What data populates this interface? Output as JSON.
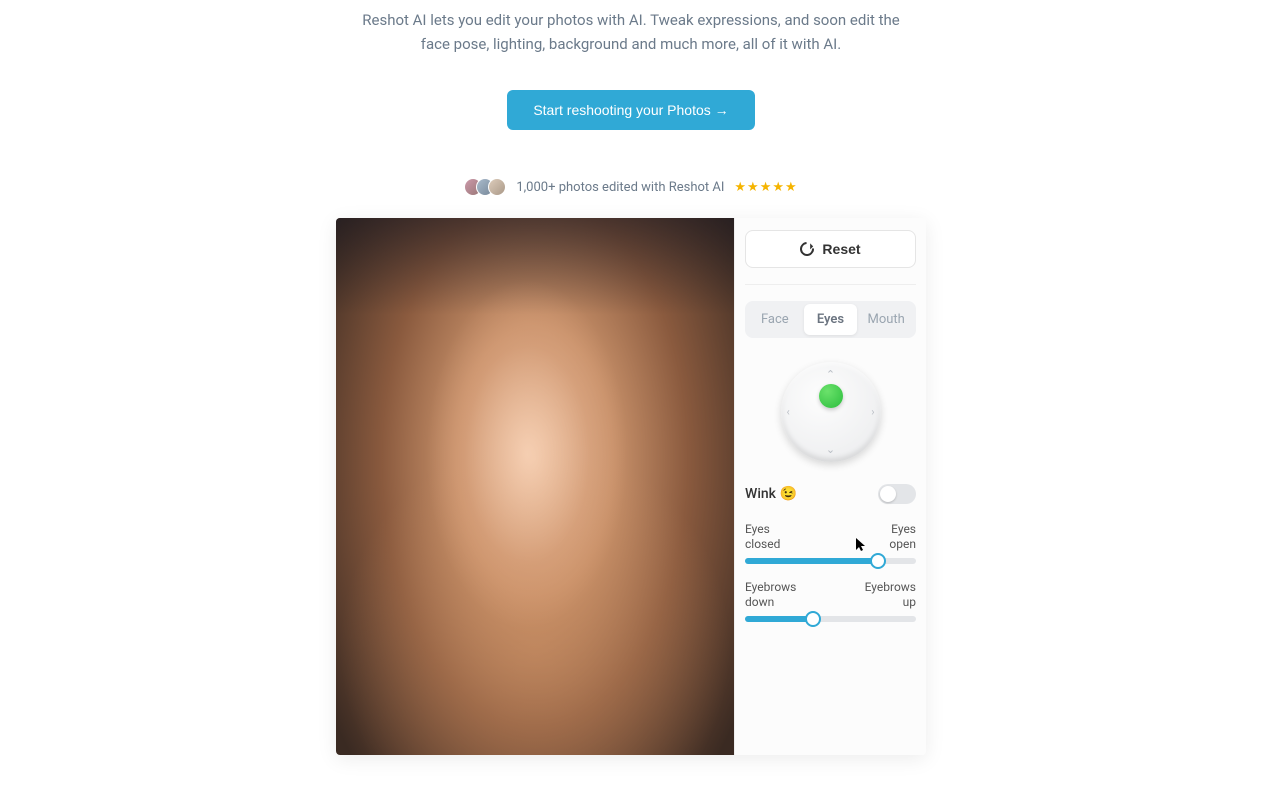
{
  "hero": {
    "subtitle_line1": "Reshot AI lets you edit your photos with AI. Tweak expressions, and soon edit the",
    "subtitle_line2": "face pose, lighting, background and much more, all of it with AI.",
    "cta_label": "Start reshooting your Photos →"
  },
  "social": {
    "text": "1,000+ photos edited with Reshot AI",
    "stars": "★★★★★"
  },
  "controls": {
    "reset_label": "Reset",
    "tabs": {
      "face": "Face",
      "eyes": "Eyes",
      "mouth": "Mouth"
    },
    "active_tab": "eyes",
    "wink_label": "Wink 😉",
    "wink_on": false,
    "slider1": {
      "left_label": "Eyes\nclosed",
      "right_label": "Eyes\nopen",
      "value": 78
    },
    "slider2": {
      "left_label": "Eyebrows\ndown",
      "right_label": "Eyebrows\nup",
      "value": 40
    }
  }
}
